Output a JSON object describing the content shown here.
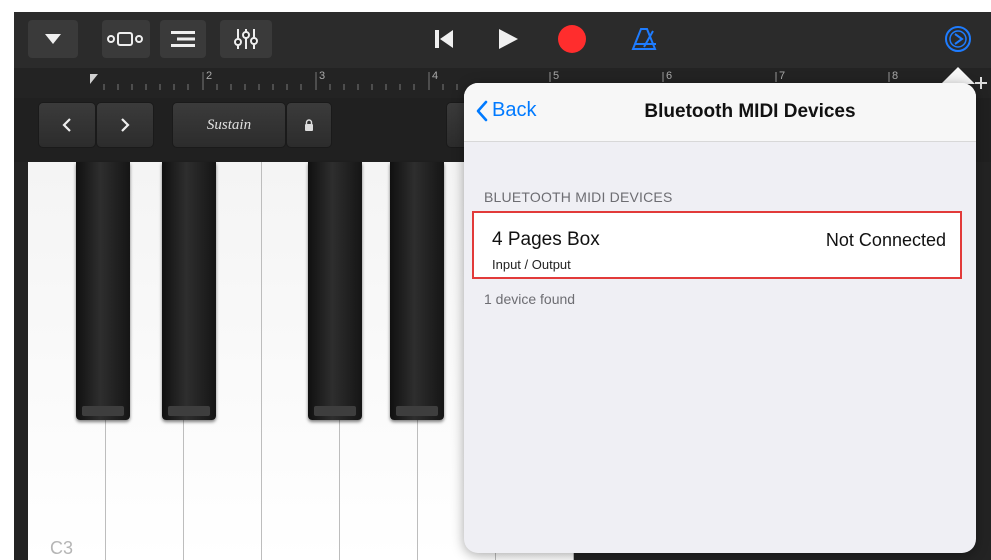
{
  "ruler": {
    "marks": [
      "2",
      "3",
      "4",
      "5",
      "6",
      "7",
      "8"
    ]
  },
  "controls": {
    "sustain_label": "Sustain"
  },
  "keyboard": {
    "c_label": "C3"
  },
  "popover": {
    "back_label": "Back",
    "title": "Bluetooth MIDI Devices",
    "section_header": "BLUETOOTH MIDI DEVICES",
    "devices": [
      {
        "name": "4 Pages Box",
        "subtitle": "Input / Output",
        "status": "Not Connected"
      }
    ],
    "footer": "1 device found"
  },
  "colors": {
    "accent": "#007aff",
    "record": "#ff2d2d",
    "highlight": "#e23a3a"
  },
  "icons": [
    "menu-triangle-icon",
    "track-view-icon",
    "tracks-list-icon",
    "mixer-icon",
    "go-to-beginning-icon",
    "play-icon",
    "record-icon",
    "metronome-icon",
    "settings-gear-icon",
    "lock-icon",
    "plus-icon"
  ]
}
